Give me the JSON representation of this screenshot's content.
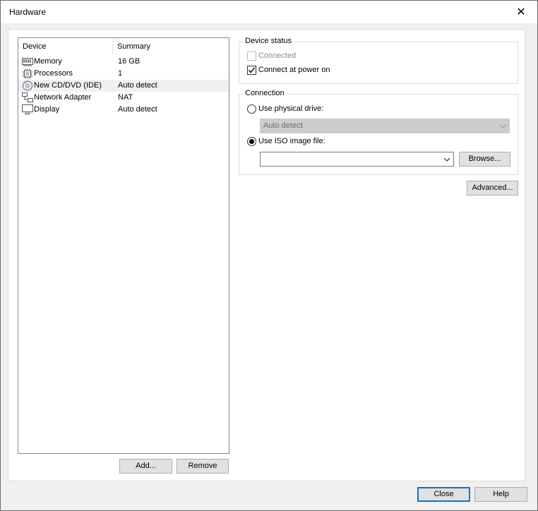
{
  "window": {
    "title": "Hardware",
    "close_glyph": "✕"
  },
  "device_list": {
    "columns": {
      "device": "Device",
      "summary": "Summary"
    },
    "rows": [
      {
        "icon": "memory-icon",
        "name": "Memory",
        "summary": "16 GB",
        "selected": false
      },
      {
        "icon": "processor-icon",
        "name": "Processors",
        "summary": "1",
        "selected": false
      },
      {
        "icon": "cd-dvd-icon",
        "name": "New CD/DVD (IDE)",
        "summary": "Auto detect",
        "selected": true
      },
      {
        "icon": "network-adapter-icon",
        "name": "Network Adapter",
        "summary": "NAT",
        "selected": false
      },
      {
        "icon": "display-icon",
        "name": "Display",
        "summary": "Auto detect",
        "selected": false
      }
    ]
  },
  "list_buttons": {
    "add": "Add...",
    "remove": "Remove"
  },
  "device_status": {
    "label": "Device status",
    "connected": {
      "label": "Connected",
      "checked": false,
      "disabled": true
    },
    "connect_at_power_on": {
      "label": "Connect at power on",
      "checked": true
    }
  },
  "connection": {
    "label": "Connection",
    "physical_drive": {
      "label": "Use physical drive:",
      "selected": false,
      "combo_value": "Auto detect"
    },
    "iso_image": {
      "label": "Use ISO image file:",
      "selected": true,
      "combo_value": ""
    },
    "browse": "Browse..."
  },
  "advanced": "Advanced...",
  "footer": {
    "close": "Close",
    "help": "Help"
  }
}
